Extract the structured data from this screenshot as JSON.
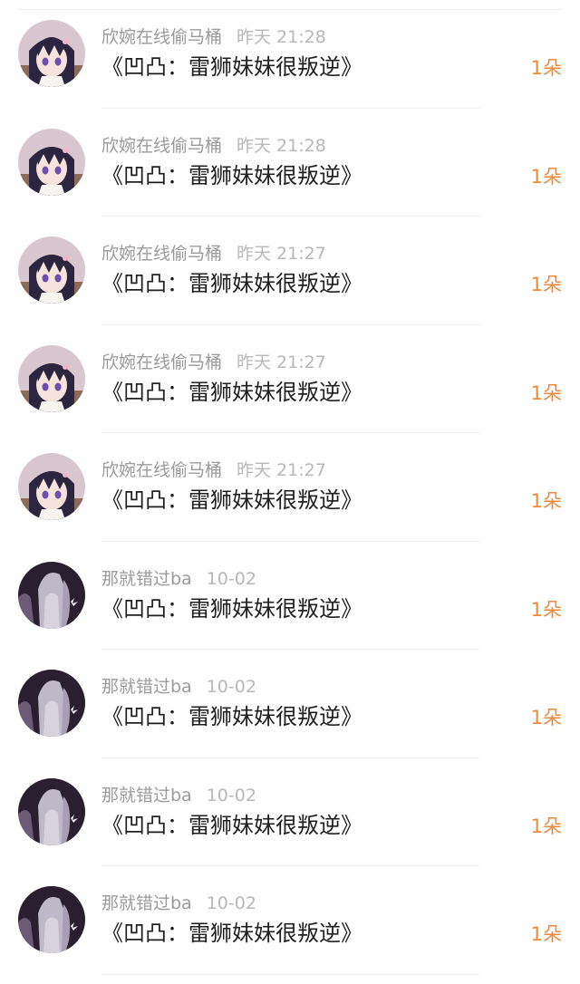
{
  "gift_list": {
    "rows": [
      {
        "username": "欣婉在线偷马桶",
        "time": "昨天 21:28",
        "title": "《凹凸：雷狮妹妹很叛逆》",
        "count": "1朵",
        "avatar": "avatar-anime-girl-dark-hair"
      },
      {
        "username": "欣婉在线偷马桶",
        "time": "昨天 21:28",
        "title": "《凹凸：雷狮妹妹很叛逆》",
        "count": "1朵",
        "avatar": "avatar-anime-girl-dark-hair"
      },
      {
        "username": "欣婉在线偷马桶",
        "time": "昨天 21:27",
        "title": "《凹凸：雷狮妹妹很叛逆》",
        "count": "1朵",
        "avatar": "avatar-anime-girl-dark-hair"
      },
      {
        "username": "欣婉在线偷马桶",
        "time": "昨天 21:27",
        "title": "《凹凸：雷狮妹妹很叛逆》",
        "count": "1朵",
        "avatar": "avatar-anime-girl-dark-hair"
      },
      {
        "username": "欣婉在线偷马桶",
        "time": "昨天 21:27",
        "title": "《凹凸：雷狮妹妹很叛逆》",
        "count": "1朵",
        "avatar": "avatar-anime-girl-dark-hair"
      },
      {
        "username": "那就错过ba",
        "time": "10-02",
        "title": "《凹凸：雷狮妹妹很叛逆》",
        "count": "1朵",
        "avatar": "avatar-silver-hair-figure"
      },
      {
        "username": "那就错过ba",
        "time": "10-02",
        "title": "《凹凸：雷狮妹妹很叛逆》",
        "count": "1朵",
        "avatar": "avatar-silver-hair-figure"
      },
      {
        "username": "那就错过ba",
        "time": "10-02",
        "title": "《凹凸：雷狮妹妹很叛逆》",
        "count": "1朵",
        "avatar": "avatar-silver-hair-figure"
      },
      {
        "username": "那就错过ba",
        "time": "10-02",
        "title": "《凹凸：雷狮妹妹很叛逆》",
        "count": "1朵",
        "avatar": "avatar-silver-hair-figure"
      }
    ]
  },
  "colors": {
    "count_accent": "#f0883a",
    "username": "#9b9b9b",
    "timestamp": "#b8b8b8",
    "title": "#1f1f1f"
  }
}
